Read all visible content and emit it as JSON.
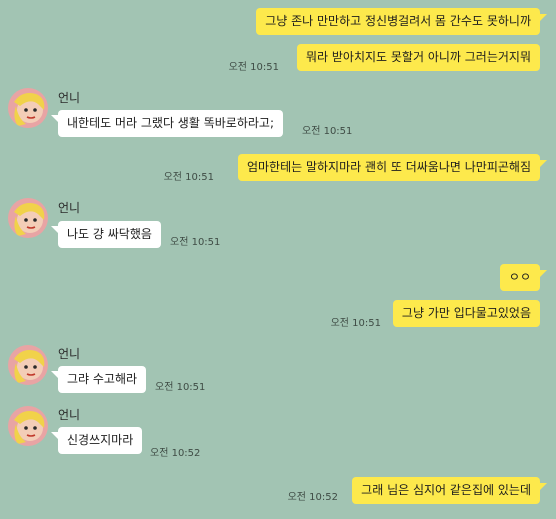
{
  "chat": {
    "sender_name": "언니",
    "colors": {
      "background": "#a2c4b3",
      "my_bubble": "#fde94c",
      "other_bubble": "#ffffff"
    },
    "messages": [
      {
        "from": "me",
        "text": "그냥 존나 만만하고 정신병걸려서 몸 간수도 못하니까",
        "time": ""
      },
      {
        "from": "me",
        "text": "뭐라 받아치지도 못할거 아니까 그러는거지뭐",
        "time": "오전 10:51"
      },
      {
        "from": "other",
        "text": "내한테도 머라 그랬다 생활 똑바로하라고;",
        "time": "오전 10:51"
      },
      {
        "from": "me",
        "text": "엄마한테는 말하지마라 괜히 또 더싸움나면 나만피곤해짐",
        "time": "오전 10:51"
      },
      {
        "from": "other",
        "text": "나도 걍 싸닥했음",
        "time": "오전 10:51"
      },
      {
        "from": "me",
        "text": "ㅇㅇ",
        "time": ""
      },
      {
        "from": "me",
        "text": "그냥 가만 입다물고있었음",
        "time": "오전 10:51"
      },
      {
        "from": "other",
        "text": "그랴 수고해라",
        "time": "오전 10:51"
      },
      {
        "from": "other",
        "text": "신경쓰지마라",
        "time": "오전 10:52"
      },
      {
        "from": "me",
        "text": "그래 님은 심지어 같은집에 있는데",
        "time": "오전 10:52"
      }
    ]
  }
}
